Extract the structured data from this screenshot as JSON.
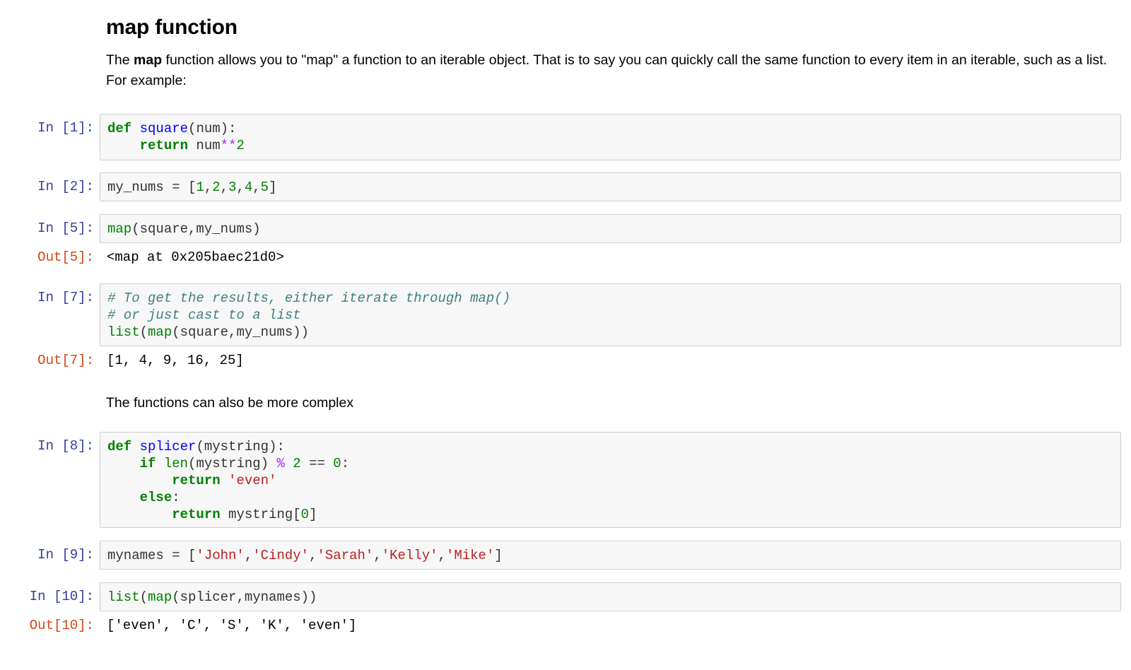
{
  "heading": "map function",
  "intro": {
    "before": "The ",
    "bold": "map",
    "after": " function allows you to \"map\" a function to an iterable object. That is to say you can quickly call the same function to every item in an iterable, such as a list. For example:"
  },
  "prompts": {
    "in1": "In [1]:",
    "in2": "In [2]:",
    "in5": "In [5]:",
    "out5": "Out[5]:",
    "in7": "In [7]:",
    "out7": "Out[7]:",
    "in8": "In [8]:",
    "in9": "In [9]:",
    "in10": "In [10]:",
    "out10": "Out[10]:"
  },
  "cell1": {
    "l1": [
      [
        "kw",
        "def"
      ],
      [
        "pl",
        " "
      ],
      [
        "fn",
        "square"
      ],
      [
        "pl",
        "(num):"
      ]
    ],
    "l2": [
      [
        "pl",
        "    "
      ],
      [
        "kw",
        "return"
      ],
      [
        "pl",
        " num"
      ],
      [
        "op",
        "**"
      ],
      [
        "num",
        "2"
      ]
    ]
  },
  "cell2": {
    "l1": [
      [
        "pl",
        "my_nums = ["
      ],
      [
        "num",
        "1"
      ],
      [
        "pl",
        ","
      ],
      [
        "num",
        "2"
      ],
      [
        "pl",
        ","
      ],
      [
        "num",
        "3"
      ],
      [
        "pl",
        ","
      ],
      [
        "num",
        "4"
      ],
      [
        "pl",
        ","
      ],
      [
        "num",
        "5"
      ],
      [
        "pl",
        "]"
      ]
    ]
  },
  "cell5": {
    "l1": [
      [
        "bi",
        "map"
      ],
      [
        "pl",
        "(square,my_nums)"
      ]
    ]
  },
  "out5": "<map at 0x205baec21d0>",
  "cell7": {
    "l1": [
      [
        "cm",
        "# To get the results, either iterate through map()"
      ]
    ],
    "l2": [
      [
        "cm",
        "# or just cast to a list"
      ]
    ],
    "l3": [
      [
        "bi",
        "list"
      ],
      [
        "pl",
        "("
      ],
      [
        "bi",
        "map"
      ],
      [
        "pl",
        "(square,my_nums))"
      ]
    ]
  },
  "out7": "[1, 4, 9, 16, 25]",
  "middle_text": "The functions can also be more complex",
  "cell8": {
    "l1": [
      [
        "kw",
        "def"
      ],
      [
        "pl",
        " "
      ],
      [
        "fn",
        "splicer"
      ],
      [
        "pl",
        "(mystring):"
      ]
    ],
    "l2": [
      [
        "pl",
        "    "
      ],
      [
        "kw",
        "if"
      ],
      [
        "pl",
        " "
      ],
      [
        "bi",
        "len"
      ],
      [
        "pl",
        "(mystring) "
      ],
      [
        "op",
        "%"
      ],
      [
        "pl",
        " "
      ],
      [
        "num",
        "2"
      ],
      [
        "pl",
        " == "
      ],
      [
        "num",
        "0"
      ],
      [
        "pl",
        ":"
      ]
    ],
    "l3": [
      [
        "pl",
        "        "
      ],
      [
        "kw",
        "return"
      ],
      [
        "pl",
        " "
      ],
      [
        "str",
        "'even'"
      ]
    ],
    "l4": [
      [
        "pl",
        "    "
      ],
      [
        "kw",
        "else"
      ],
      [
        "pl",
        ":"
      ]
    ],
    "l5": [
      [
        "pl",
        "        "
      ],
      [
        "kw",
        "return"
      ],
      [
        "pl",
        " mystring["
      ],
      [
        "num",
        "0"
      ],
      [
        "pl",
        "]"
      ]
    ]
  },
  "cell9": {
    "l1": [
      [
        "pl",
        "mynames = ["
      ],
      [
        "str",
        "'John'"
      ],
      [
        "pl",
        ","
      ],
      [
        "str",
        "'Cindy'"
      ],
      [
        "pl",
        ","
      ],
      [
        "str",
        "'Sarah'"
      ],
      [
        "pl",
        ","
      ],
      [
        "str",
        "'Kelly'"
      ],
      [
        "pl",
        ","
      ],
      [
        "str",
        "'Mike'"
      ],
      [
        "pl",
        "]"
      ]
    ]
  },
  "cell10": {
    "l1": [
      [
        "bi",
        "list"
      ],
      [
        "pl",
        "("
      ],
      [
        "bi",
        "map"
      ],
      [
        "pl",
        "(splicer,mynames))"
      ]
    ]
  },
  "out10": "['even', 'C', 'S', 'K', 'even']"
}
